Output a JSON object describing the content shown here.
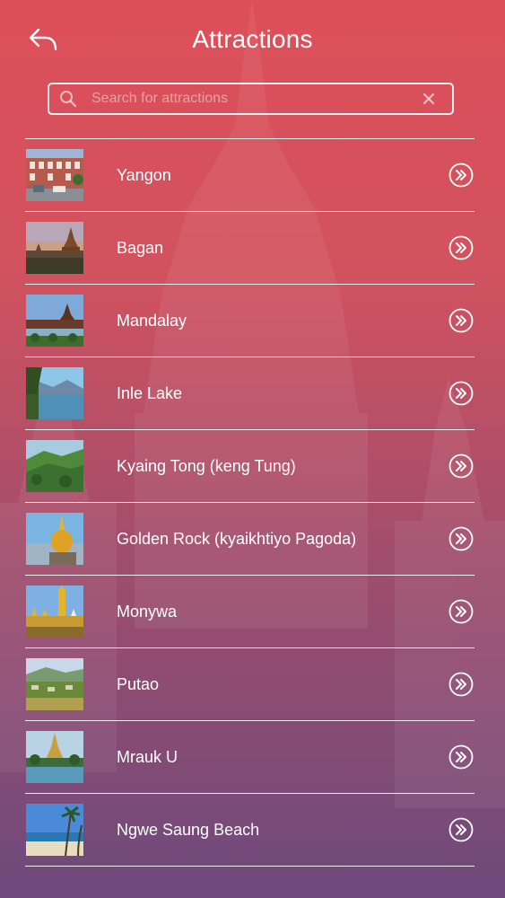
{
  "header": {
    "title": "Attractions",
    "back_icon": "back-arrow-icon"
  },
  "search": {
    "placeholder": "Search for attractions",
    "value": "",
    "search_icon": "magnifier-icon",
    "clear_icon": "close-x-icon"
  },
  "attractions": [
    {
      "label": "Yangon",
      "thumb": "colonial-street-photo",
      "action_icon": "double-chevron-right-icon"
    },
    {
      "label": "Bagan",
      "thumb": "temple-sunset-photo",
      "action_icon": "double-chevron-right-icon"
    },
    {
      "label": "Mandalay",
      "thumb": "palace-moat-photo",
      "action_icon": "double-chevron-right-icon"
    },
    {
      "label": "Inle Lake",
      "thumb": "lake-mountains-photo",
      "action_icon": "double-chevron-right-icon"
    },
    {
      "label": "Kyaing Tong (keng Tung)",
      "thumb": "green-hills-photo",
      "action_icon": "double-chevron-right-icon"
    },
    {
      "label": "Golden Rock (kyaikhtiyo Pagoda)",
      "thumb": "golden-rock-photo",
      "action_icon": "double-chevron-right-icon"
    },
    {
      "label": "Monywa",
      "thumb": "golden-stupas-photo",
      "action_icon": "double-chevron-right-icon"
    },
    {
      "label": "Putao",
      "thumb": "valley-houses-photo",
      "action_icon": "double-chevron-right-icon"
    },
    {
      "label": "Mrauk U",
      "thumb": "stupa-water-photo",
      "action_icon": "double-chevron-right-icon"
    },
    {
      "label": "Ngwe Saung Beach",
      "thumb": "palm-beach-photo",
      "action_icon": "double-chevron-right-icon"
    }
  ],
  "colors": {
    "bg_top": "#dd4f58",
    "bg_bottom": "#6d4a7c",
    "foreground": "#ffffff"
  }
}
